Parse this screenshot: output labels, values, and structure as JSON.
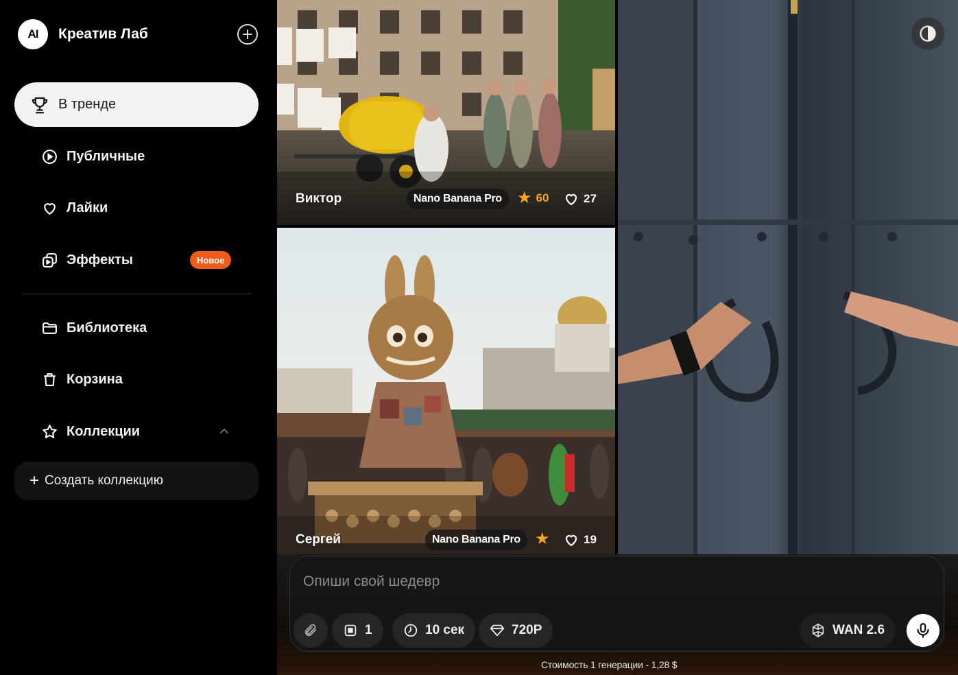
{
  "app": {
    "logo_text": "AI",
    "name": "Креатив Лаб"
  },
  "sidebar": {
    "active": {
      "label": "В тренде",
      "icon": "trophy-icon"
    },
    "items": [
      {
        "label": "Публичные",
        "icon": "play-circle-icon"
      },
      {
        "label": "Лайки",
        "icon": "heart-icon"
      },
      {
        "label": "Эффекты",
        "icon": "effects-icon",
        "badge": "Новое"
      },
      {
        "label": "Библиотека",
        "icon": "folder-icon"
      },
      {
        "label": "Корзина",
        "icon": "trash-icon"
      },
      {
        "label": "Коллекции",
        "icon": "star-icon"
      }
    ],
    "create_collection": {
      "plus": "+",
      "label": "Создать коллекцию"
    }
  },
  "gallery": [
    {
      "author": "Виктор",
      "model": "Nano Banana Pro",
      "stars": "60",
      "likes": "27"
    },
    {
      "author": "Сергей",
      "model": "Nano Banana Pro",
      "stars": "",
      "likes": "19"
    }
  ],
  "prompt": {
    "placeholder": "Опиши свой шедевр",
    "chips": {
      "count": "1",
      "duration": "10 сек",
      "quality": "720P",
      "model": "WAN 2.6"
    },
    "cost": "Стоимость 1 генерации - 1,28 $"
  },
  "colors": {
    "accent": "#f05a1a",
    "star": "#f5a623",
    "active_bg": "#f2f2f2"
  }
}
